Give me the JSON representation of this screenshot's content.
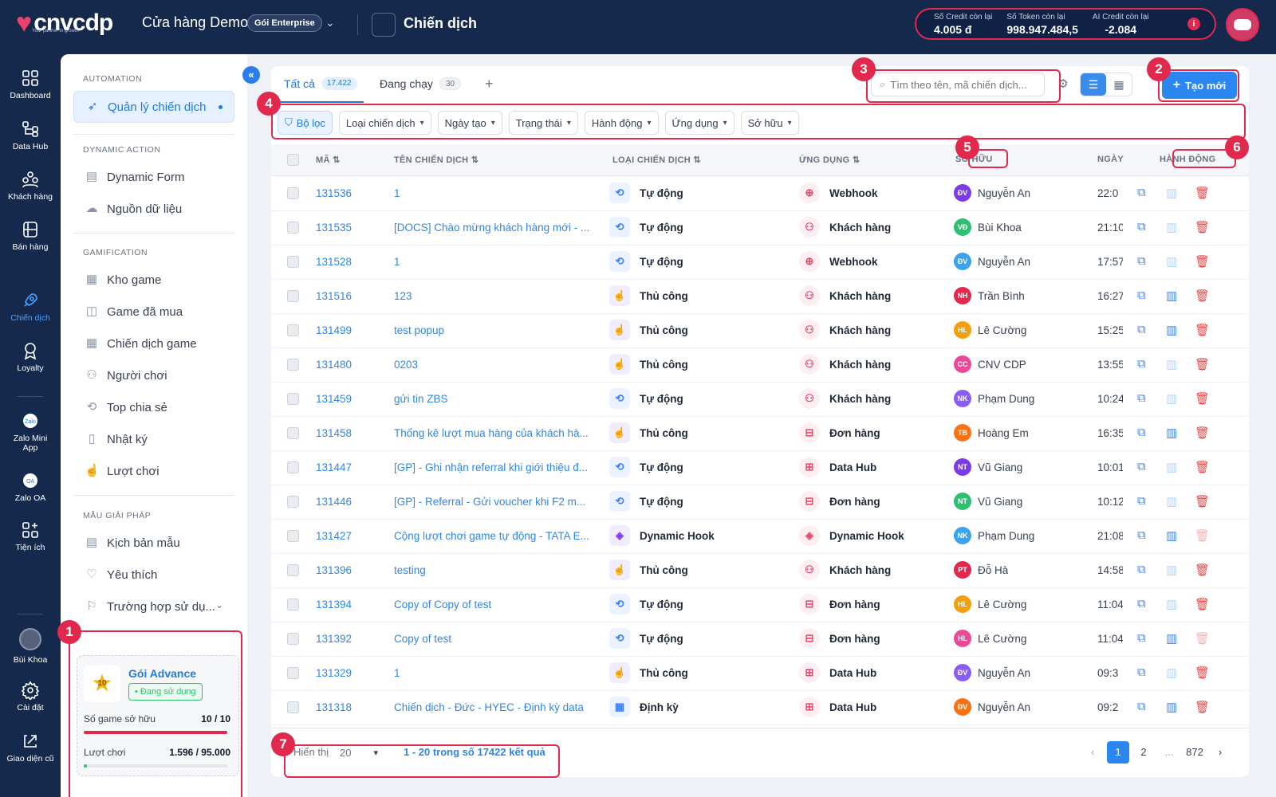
{
  "brand": {
    "logo_text": "cnvcdp",
    "logo_tagline": "Your partner in growth"
  },
  "topbar": {
    "store_name": "Cửa hàng Demo",
    "plan_label": "Gói Enterprise",
    "page_title": "Chiến dịch",
    "credits": [
      {
        "label": "Số Credit còn lại",
        "value": "4.005 đ"
      },
      {
        "label": "Số Token còn lại",
        "value": "998.947.484,5"
      },
      {
        "label": "AI Credit còn lại",
        "value": "-2.084"
      }
    ]
  },
  "rail": [
    {
      "label": "Dashboard",
      "icon": "dashboard-icon",
      "active": false
    },
    {
      "label": "Data Hub",
      "icon": "data-hub-icon",
      "active": false
    },
    {
      "label": "Khách hàng",
      "icon": "customers-icon",
      "active": false
    },
    {
      "label": "Bán hàng",
      "icon": "sales-icon",
      "active": false
    },
    {
      "label": "Chiến dịch",
      "icon": "rocket-icon",
      "active": true
    },
    {
      "label": "Loyalty",
      "icon": "loyalty-icon",
      "active": false
    },
    {
      "label": "Zalo Mini App",
      "icon": "zalo-mini-app-icon",
      "active": false
    },
    {
      "label": "Zalo OA",
      "icon": "zalo-oa-icon",
      "active": false
    },
    {
      "label": "Tiện ích",
      "icon": "utilities-icon",
      "active": false
    }
  ],
  "rail_bottom": {
    "user_name": "Bùi Khoa",
    "settings": "Cài đặt",
    "legacy": "Giao diện cũ"
  },
  "subnav": {
    "sections": {
      "automation": "AUTOMATION",
      "dynamic": "DYNAMIC ACTION",
      "gamification": "GAMIFICATION",
      "templates": "MẪU GIẢI PHÁP"
    },
    "items": {
      "campaign_mgmt": "Quản lý chiến dịch",
      "dynamic_form": "Dynamic Form",
      "data_source": "Nguồn dữ liệu",
      "game_store": "Kho game",
      "purchased_games": "Game đã mua",
      "game_campaigns": "Chiến dịch game",
      "players": "Người chơi",
      "top_share": "Top chia sẻ",
      "log": "Nhật ký",
      "plays": "Lượt chơi",
      "template_scripts": "Kịch bản mẫu",
      "favorites": "Yêu thích",
      "use_cases": "Trường hợp sử dụ..."
    }
  },
  "package": {
    "level": "10",
    "name": "Gói Advance",
    "status": "Đang sử dụng",
    "games_label": "Số game sở hữu",
    "games_value": "10 / 10",
    "games_fill": 1.0,
    "plays_label": "Lượt chơi",
    "plays_value": "1.596 / 95.000",
    "plays_fill": 0.017
  },
  "tabs": [
    {
      "label": "Tất cả",
      "count": "17.422"
    },
    {
      "label": "Đang chạy",
      "count": "30"
    }
  ],
  "search": {
    "placeholder": "Tìm theo tên, mã chiến dịch..."
  },
  "create_button": "Tạo mới",
  "filters": [
    "Bộ lọc",
    "Loại chiến dịch",
    "Ngày tạo",
    "Trạng thái",
    "Hành động",
    "Ứng dụng",
    "Sở hữu"
  ],
  "table": {
    "columns": {
      "id": "MÃ",
      "name": "TÊN CHIẾN DỊCH",
      "type": "LOẠI CHIẾN DỊCH",
      "app": "ỨNG DỤNG",
      "owner": "SỞ HỮU",
      "date": "NGÀY",
      "actions": "HÀNH ĐỘNG"
    },
    "rows": [
      {
        "id": "131536",
        "name": "1",
        "type": "Tự động",
        "app": "Webhook",
        "owner_initials": "ĐV",
        "owner": "Nguyễn An",
        "date": "22:0",
        "stats_active": false,
        "del_active": true
      },
      {
        "id": "131535",
        "name": "[DOCS] Chào mừng khách hàng mới - ...",
        "type": "Tự động",
        "app": "Khách hàng",
        "owner_initials": "VĐ",
        "owner": "Bùi Khoa",
        "date": "21:10",
        "stats_active": false,
        "del_active": true
      },
      {
        "id": "131528",
        "name": "1",
        "type": "Tự động",
        "app": "Webhook",
        "owner_initials": "ĐV",
        "owner": "Nguyễn An",
        "date": "17:57",
        "stats_active": false,
        "del_active": true
      },
      {
        "id": "131516",
        "name": "123",
        "type": "Thủ công",
        "app": "Khách hàng",
        "owner_initials": "NH",
        "owner": "Trần Bình",
        "date": "16:27",
        "stats_active": true,
        "del_active": true
      },
      {
        "id": "131499",
        "name": "test popup",
        "type": "Thủ công",
        "app": "Khách hàng",
        "owner_initials": "HL",
        "owner": "Lê Cường",
        "date": "15:25",
        "stats_active": true,
        "del_active": true
      },
      {
        "id": "131480",
        "name": "0203",
        "type": "Thủ công",
        "app": "Khách hàng",
        "owner_initials": "CC",
        "owner": "CNV CDP",
        "date": "13:55",
        "stats_active": false,
        "del_active": true
      },
      {
        "id": "131459",
        "name": "gửi tin ZBS",
        "type": "Tự động",
        "app": "Khách hàng",
        "owner_initials": "NK",
        "owner": "Phạm Dung",
        "date": "10:24",
        "stats_active": false,
        "del_active": true
      },
      {
        "id": "131458",
        "name": "Thống kê lượt mua hàng của khách hà...",
        "type": "Thủ công",
        "app": "Đơn hàng",
        "owner_initials": "TB",
        "owner": "Hoàng Em",
        "date": "16:35",
        "stats_active": true,
        "del_active": true
      },
      {
        "id": "131447",
        "name": "[GP] - Ghi nhận referral khi giới thiệu đ...",
        "type": "Tự động",
        "app": "Data Hub",
        "owner_initials": "NT",
        "owner": "Vũ Giang",
        "date": "10:01",
        "stats_active": false,
        "del_active": true
      },
      {
        "id": "131446",
        "name": "[GP] - Referral - Gửi voucher khi F2 m...",
        "type": "Tự động",
        "app": "Đơn hàng",
        "owner_initials": "NT",
        "owner": "Vũ Giang",
        "date": "10:12",
        "stats_active": false,
        "del_active": true
      },
      {
        "id": "131427",
        "name": "Cộng lượt chơi game tự động - TATA E...",
        "type": "Dynamic Hook",
        "app": "Dynamic Hook",
        "owner_initials": "NK",
        "owner": "Phạm Dung",
        "date": "21:08",
        "stats_active": true,
        "del_active": false
      },
      {
        "id": "131396",
        "name": "testing",
        "type": "Thủ công",
        "app": "Khách hàng",
        "owner_initials": "PT",
        "owner": "Đỗ Hà",
        "date": "14:58",
        "stats_active": false,
        "del_active": true
      },
      {
        "id": "131394",
        "name": "Copy of Copy of test",
        "type": "Tự động",
        "app": "Đơn hàng",
        "owner_initials": "HL",
        "owner": "Lê Cường",
        "date": "11:04",
        "stats_active": false,
        "del_active": true
      },
      {
        "id": "131392",
        "name": "Copy of test",
        "type": "Tự động",
        "app": "Đơn hàng",
        "owner_initials": "HL",
        "owner": "Lê Cường",
        "date": "11:04",
        "stats_active": true,
        "del_active": false
      },
      {
        "id": "131329",
        "name": "1",
        "type": "Thủ công",
        "app": "Data Hub",
        "owner_initials": "ĐV",
        "owner": "Nguyễn An",
        "date": "09:3",
        "stats_active": false,
        "del_active": true
      },
      {
        "id": "131318",
        "name": "Chiến dịch - Đức - HYEC - Định kỳ data",
        "type": "Định kỳ",
        "app": "Data Hub",
        "owner_initials": "ĐV",
        "owner": "Nguyễn An",
        "date": "09:2",
        "stats_active": true,
        "del_active": true
      }
    ]
  },
  "footer": {
    "show_label": "Hiển thị",
    "page_size": "20",
    "result_text": "1 - 20 trong số 17422 kết quả",
    "pages": [
      "1",
      "2",
      "...",
      "872"
    ],
    "current_page": "1"
  },
  "annotations": [
    "1",
    "2",
    "3",
    "4",
    "5",
    "6",
    "7"
  ],
  "colors": {
    "accent": "#2b86f0",
    "highlight": "#e0294d",
    "topbar": "#15294d"
  }
}
